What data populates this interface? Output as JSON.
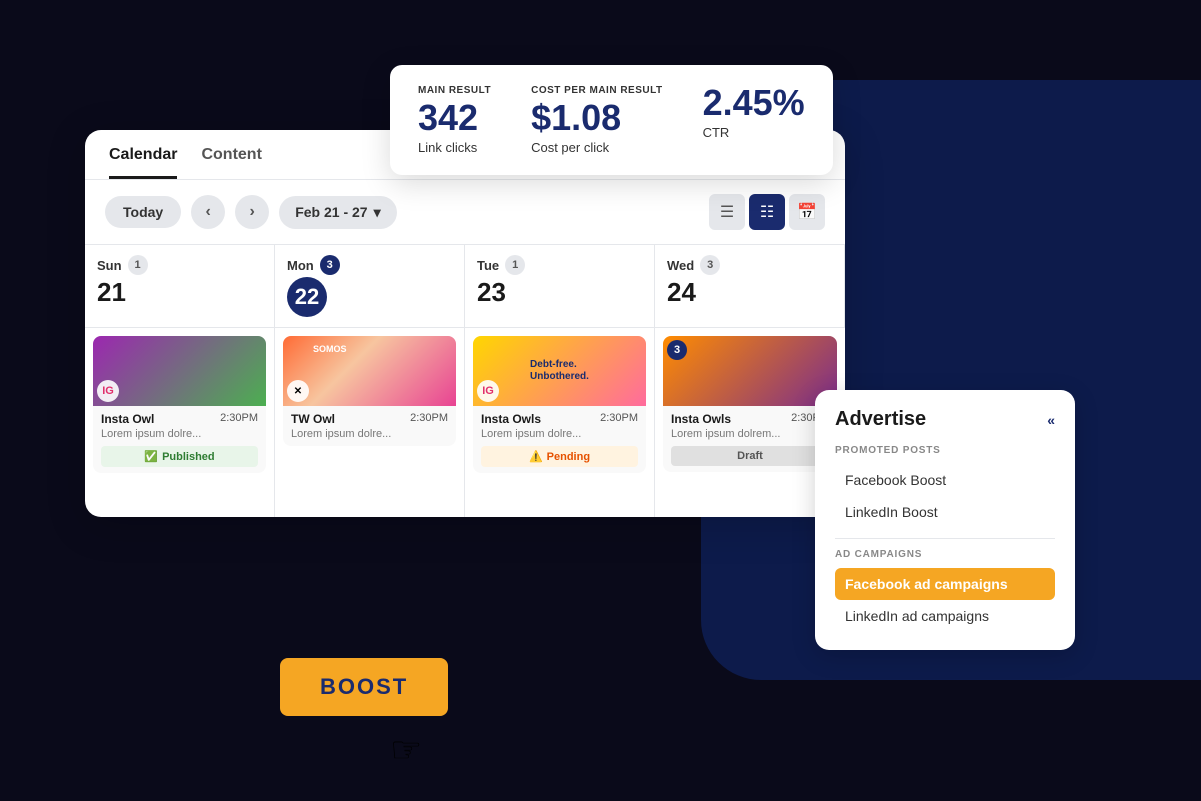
{
  "background": {
    "arc_color": "#0d1b4b"
  },
  "stats_card": {
    "main_result_label": "MAIN RESULT",
    "main_result_value": "342",
    "main_result_sublabel": "Link clicks",
    "cost_label": "COST PER MAIN RESULT",
    "cost_value": "$1.08",
    "cost_sublabel": "Cost per click",
    "ctr_value": "2.45%",
    "ctr_label": "CTR"
  },
  "tabs": [
    {
      "label": "Calendar",
      "active": true
    },
    {
      "label": "Content",
      "active": false
    }
  ],
  "toolbar": {
    "today_label": "Today",
    "prev_label": "‹",
    "next_label": "›",
    "date_range": "Feb 21 - 27",
    "dropdown_arrow": "▾"
  },
  "view_buttons": [
    {
      "icon": "≡",
      "label": "list-view",
      "active": false
    },
    {
      "icon": "⊞",
      "label": "grid-view",
      "active": true
    },
    {
      "icon": "📅",
      "label": "calendar-view",
      "active": false
    }
  ],
  "days": [
    {
      "name": "Sun",
      "number": "21",
      "badge": "1",
      "badge_style": "normal",
      "circle": false
    },
    {
      "name": "Mon",
      "number": "22",
      "badge": "3",
      "badge_style": "dark",
      "circle": true
    },
    {
      "name": "Tue",
      "number": "23",
      "badge": "1",
      "badge_style": "normal",
      "circle": false
    },
    {
      "name": "Wed",
      "number": "24",
      "badge": "3",
      "badge_style": "normal",
      "circle": false
    }
  ],
  "posts": [
    {
      "day": 0,
      "name": "Insta Owl",
      "time": "2:30PM",
      "desc": "Lorem ipsum dolre...",
      "status": "published",
      "status_label": "Published",
      "social": "ig",
      "img_style": "purple-green"
    },
    {
      "day": 1,
      "name": "TW Owl",
      "time": "2:30PM",
      "desc": "Lorem ipsum dolre...",
      "status": "none",
      "social": "tw",
      "img_style": "orange-pink"
    },
    {
      "day": 2,
      "name": "Insta Owls",
      "time": "2:30PM",
      "desc": "Lorem ipsum dolre...",
      "status": "pending",
      "status_label": "Pending",
      "social": "ig",
      "img_style": "debt-free",
      "badge_num": null
    },
    {
      "day": 3,
      "name": "Insta Owls",
      "time": "2:30PM",
      "desc": "Lorem ipsum dolrem...",
      "status": "draft",
      "status_label": "Draft",
      "social": null,
      "img_style": "orange-purple",
      "badge_num": "3"
    }
  ],
  "advertise_panel": {
    "title": "Advertise",
    "collapse_label": "«",
    "promoted_posts_label": "PROMOTED POSTS",
    "promoted_items": [
      "Facebook Boost",
      "LinkedIn Boost"
    ],
    "ad_campaigns_label": "AD CAMPAIGNS",
    "ad_items": [
      {
        "label": "Facebook ad campaigns",
        "active": true
      },
      {
        "label": "LinkedIn ad campaigns",
        "active": false
      }
    ]
  },
  "boost_button": {
    "label": "BOOST"
  }
}
